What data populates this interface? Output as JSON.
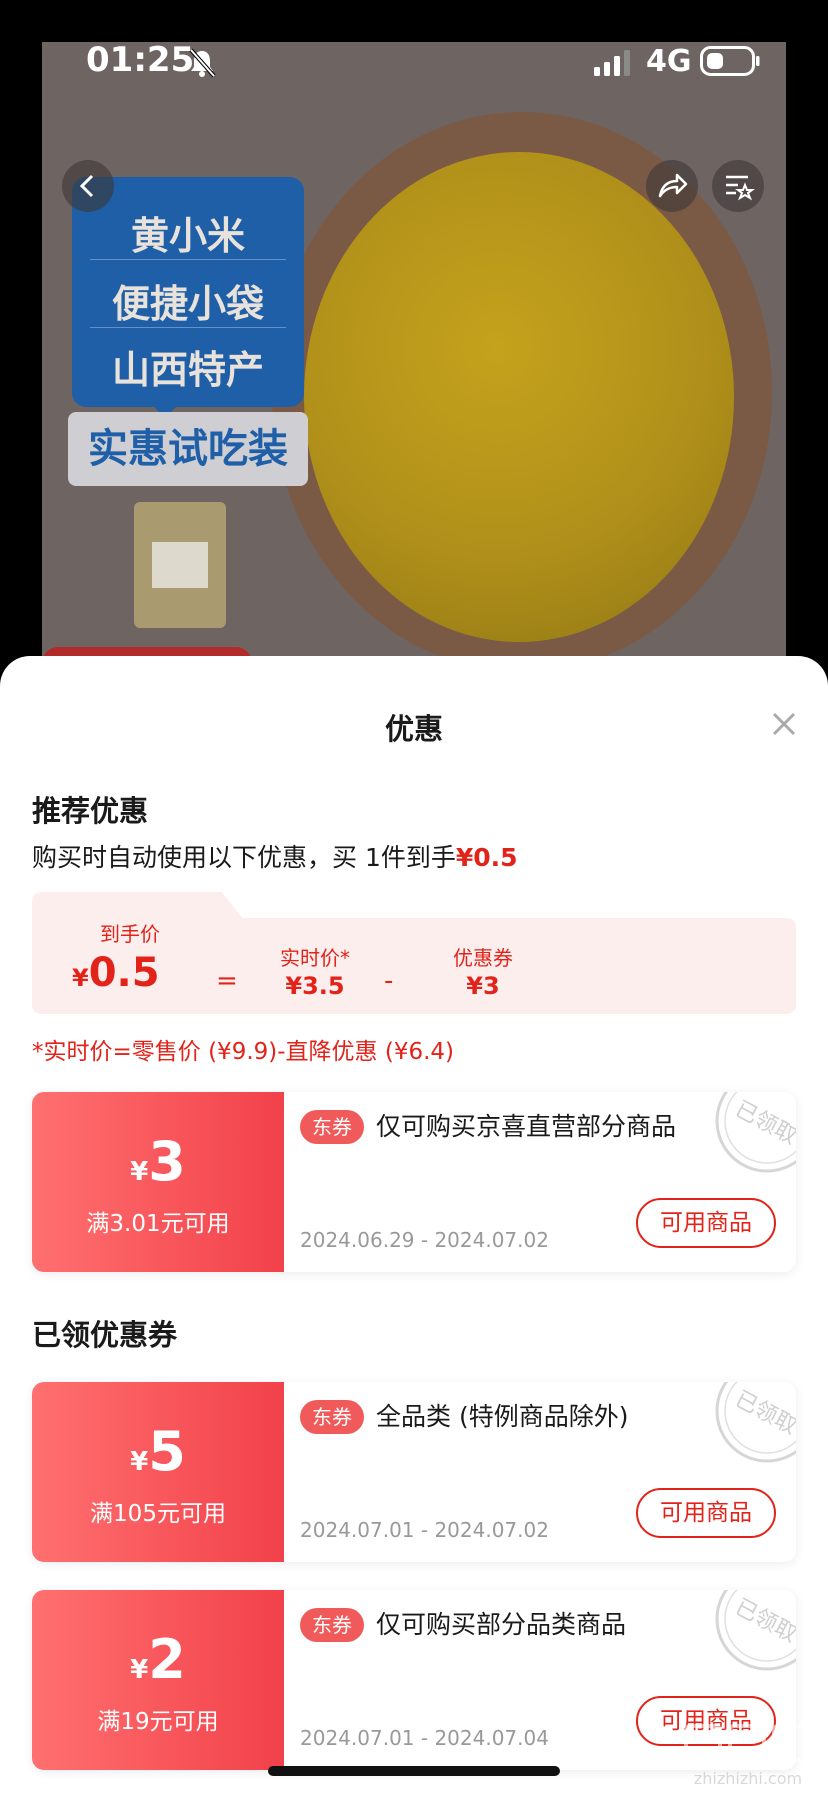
{
  "status_bar": {
    "time": "01:25",
    "network": "4G"
  },
  "product": {
    "promo_lines": [
      "黄小米",
      "便捷小袋",
      "山西特产"
    ],
    "promo_tag": "实惠试吃装"
  },
  "sheet": {
    "title": "优惠",
    "recommend": {
      "title": "推荐优惠",
      "desc_prefix": "购买时自动使用以下优惠，买 1件到手",
      "desc_price": "¥0.5"
    },
    "calc": {
      "final_label": "到手价",
      "final_yen": "¥",
      "final_value": "0.5",
      "eq": "=",
      "realtime_label": "实时价*",
      "realtime_value": "¥3.5",
      "minus": "-",
      "coupon_label": "优惠券",
      "coupon_value": "¥3"
    },
    "note": "*实时价=零售价 (¥9.9)-直降优惠 (¥6.4)",
    "claimed_title": "已领优惠券",
    "coupons": [
      {
        "yen": "¥",
        "amount": "3",
        "condition": "满3.01元可用",
        "tag": "东券",
        "desc": "仅可购买京喜直营部分商品",
        "dates": "2024.06.29 - 2024.07.02",
        "button": "可用商品",
        "stamp": "已领取"
      },
      {
        "yen": "¥",
        "amount": "5",
        "condition": "满105元可用",
        "tag": "东券",
        "desc": "全品类 (特例商品除外)",
        "dates": "2024.07.01 - 2024.07.02",
        "button": "可用商品",
        "stamp": "已领取"
      },
      {
        "yen": "¥",
        "amount": "2",
        "condition": "满19元可用",
        "tag": "东券",
        "desc": "仅可购买部分品类商品",
        "dates": "2024.07.01 - 2024.07.04",
        "button": "可用商品",
        "stamp": "已领取"
      }
    ]
  },
  "watermark": {
    "text": "zhizhizhi.com"
  },
  "colors": {
    "accent": "#e2231a",
    "coupon_gradient_start": "#ff7070",
    "coupon_gradient_end": "#f2414a"
  }
}
